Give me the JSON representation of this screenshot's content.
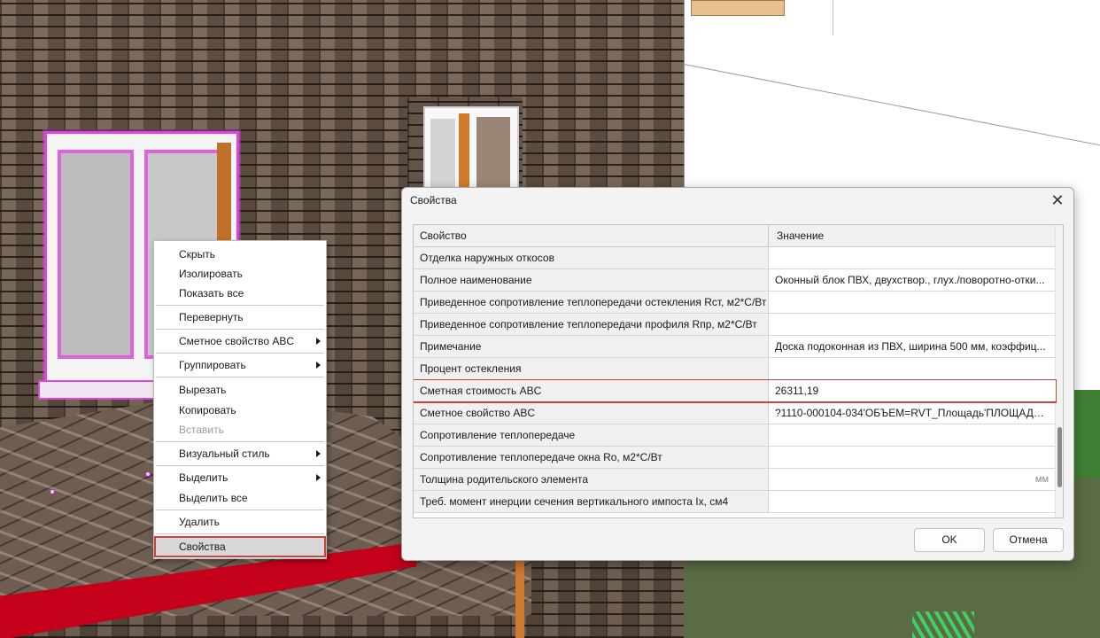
{
  "context_menu": {
    "items": [
      {
        "label": "Скрыть",
        "submenu": false,
        "disabled": false
      },
      {
        "label": "Изолировать",
        "submenu": false,
        "disabled": false
      },
      {
        "label": "Показать все",
        "submenu": false,
        "disabled": false
      },
      {
        "label": "Перевернуть",
        "submenu": false,
        "disabled": false
      },
      {
        "label": "Сметное свойство ABC",
        "submenu": true,
        "disabled": false
      },
      {
        "label": "Группировать",
        "submenu": true,
        "disabled": false
      },
      {
        "label": "Вырезать",
        "submenu": false,
        "disabled": false
      },
      {
        "label": "Копировать",
        "submenu": false,
        "disabled": false
      },
      {
        "label": "Вставить",
        "submenu": false,
        "disabled": true
      },
      {
        "label": "Визуальный стиль",
        "submenu": true,
        "disabled": false
      },
      {
        "label": "Выделить",
        "submenu": true,
        "disabled": false
      },
      {
        "label": "Выделить все",
        "submenu": false,
        "disabled": false
      },
      {
        "label": "Удалить",
        "submenu": false,
        "disabled": false
      },
      {
        "label": "Свойства",
        "submenu": false,
        "disabled": false,
        "highlighted": true
      }
    ]
  },
  "dialog": {
    "title": "Свойства",
    "close_glyph": "✕",
    "columns": {
      "property": "Свойство",
      "value": "Значение"
    },
    "rows": [
      {
        "property": "Отделка наружных откосов",
        "value": ""
      },
      {
        "property": "Полное наименование",
        "value": "Оконный блок ПВХ, двухствор., глух./поворотно-отки..."
      },
      {
        "property": "Приведенное сопротивление теплопередачи остекления Rст, м2*С/Вт",
        "value": ""
      },
      {
        "property": "Приведенное сопротивление теплопередачи профиля Rпр, м2*С/Вт",
        "value": ""
      },
      {
        "property": "Примечание",
        "value": "Доска подоконная из ПВХ, ширина 500 мм, коэффиц..."
      },
      {
        "property": "Процент остекления",
        "value": ""
      },
      {
        "property": "Сметная стоимость ABC",
        "value": "26311,19",
        "highlighted": true
      },
      {
        "property": "Сметное свойство ABC",
        "value": "?1110-000104-034'ОБЪЕМ=RVT_Площадь'ПЛОЩАДЬ=..."
      },
      {
        "property": "Сопротивление теплопередаче",
        "value": ""
      },
      {
        "property": "Сопротивление теплопередаче окна Ro, м2*С/Вт",
        "value": ""
      },
      {
        "property": "Толщина родительского элемента",
        "value": "",
        "unit": "мм"
      },
      {
        "property": "Треб. момент инерции сечения вертикального импоста Ix, см4",
        "value": ""
      }
    ],
    "ok_label": "OK",
    "cancel_label": "Отмена"
  },
  "colors": {
    "highlight_outline": "#c8443a",
    "selection_magenta": "#e044e0"
  }
}
